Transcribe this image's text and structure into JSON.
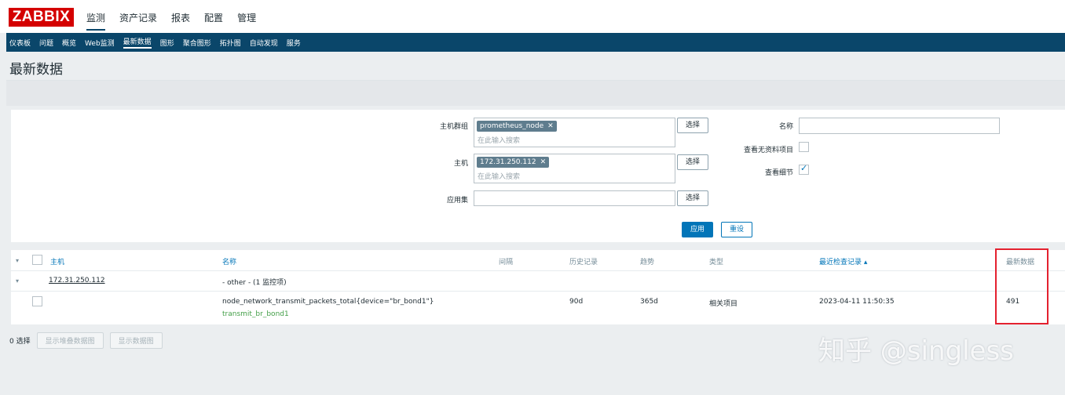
{
  "header": {
    "logo": "ZABBIX",
    "menu": [
      "监测",
      "资产记录",
      "报表",
      "配置",
      "管理"
    ]
  },
  "subnav": [
    "仪表板",
    "问题",
    "概览",
    "Web监测",
    "最新数据",
    "图形",
    "聚合图形",
    "拓扑图",
    "自动发现",
    "服务"
  ],
  "page_title": "最新数据",
  "filter": {
    "host_groups_label": "主机群组",
    "host_group_tag": "prometheus_node",
    "hosts_label": "主机",
    "host_tag": "172.31.250.112",
    "search_placeholder": "在此输入搜索",
    "application_label": "应用集",
    "select_label": "选择",
    "name_label": "名称",
    "show_no_data_label": "查看无资料项目",
    "show_details_label": "查看细节",
    "apply_label": "应用",
    "reset_label": "重设"
  },
  "table": {
    "columns": [
      "主机",
      "名称",
      "间隔",
      "历史记录",
      "趋势",
      "类型",
      "最近检查记录 ▴",
      "最新数据"
    ],
    "host_row": {
      "host": "172.31.250.112",
      "group": "- other - (1 监控项)"
    },
    "item_row": {
      "name": "node_network_transmit_packets_total{device=\"br_bond1\"}",
      "key": "transmit_br_bond1",
      "history": "90d",
      "trends": "365d",
      "type": "相关项目",
      "last_check": "2023-04-11 11:50:35",
      "last_value": "491"
    }
  },
  "footer": {
    "selected": "0 选择",
    "graph_stacked": "显示堆叠数据图",
    "graph": "显示数据图"
  },
  "watermark": "知乎 @singless",
  "colors": {
    "brand": "#d40000",
    "nav": "#0a466a",
    "link": "#0275b8",
    "highlight_box": "#e4212f"
  }
}
